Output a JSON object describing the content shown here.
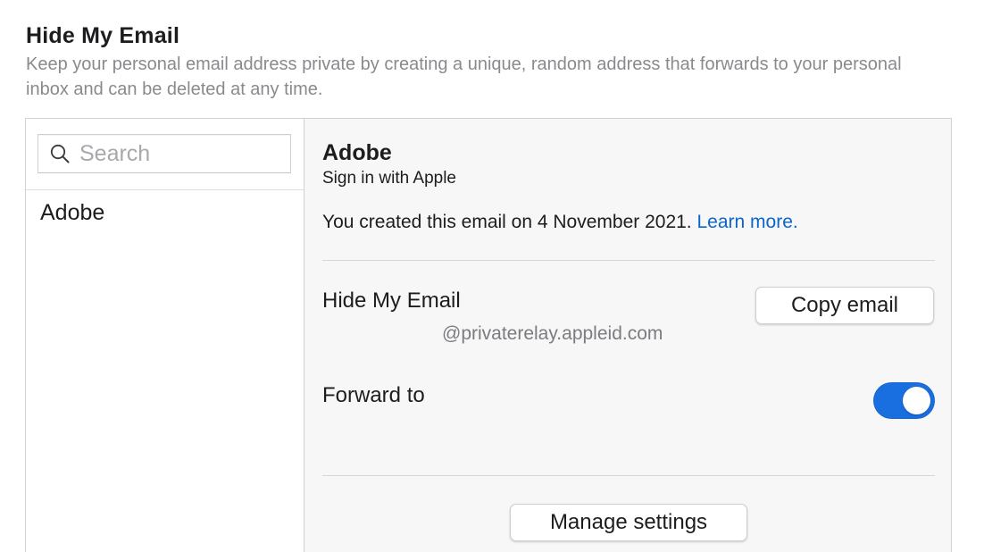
{
  "header": {
    "title": "Hide My Email",
    "description": "Keep your personal email address private by creating a unique, random address that forwards to your personal inbox and can be deleted at any time."
  },
  "sidebar": {
    "search": {
      "placeholder": "Search",
      "value": "",
      "icon": "search-icon"
    },
    "items": [
      {
        "label": "Adobe",
        "selected": true
      }
    ]
  },
  "detail": {
    "title": "Adobe",
    "subtitle": "Sign in with Apple",
    "created_text": "You created this email on 4 November 2021.",
    "learn_more_label": "Learn more.",
    "hide_my_email_label": "Hide My Email",
    "email_value": "@privaterelay.appleid.com",
    "copy_email_label": "Copy email",
    "forward_to_label": "Forward to",
    "forward_enabled": true,
    "manage_settings_label": "Manage settings"
  },
  "colors": {
    "accent": "#1a6fe0",
    "link": "#0a66c8",
    "secondary_text": "#8a8a8e",
    "detail_background": "#f7f7f7"
  }
}
